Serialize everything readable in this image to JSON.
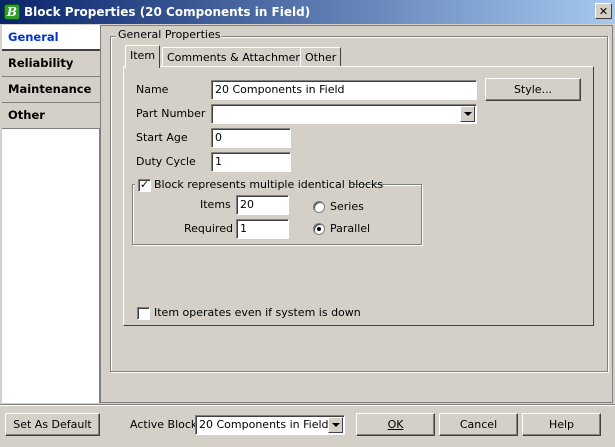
{
  "window": {
    "title": "Block Properties (20 Components in Field)",
    "close_glyph": "✕",
    "app_icon_letter": "B"
  },
  "nav": {
    "items": [
      {
        "label": "General",
        "selected": true
      },
      {
        "label": "Reliability",
        "selected": false
      },
      {
        "label": "Maintenance",
        "selected": false
      },
      {
        "label": "Other",
        "selected": false
      }
    ]
  },
  "general": {
    "group_title": "General Properties",
    "tabs": [
      {
        "label": "Item",
        "selected": true
      },
      {
        "label": "Comments & Attachments",
        "selected": false
      },
      {
        "label": "Other",
        "selected": false
      }
    ],
    "fields": {
      "name_label": "Name",
      "name_value": "20 Components in Field",
      "style_button": "Style...",
      "part_number_label": "Part Number",
      "part_number_value": "",
      "start_age_label": "Start Age",
      "start_age_value": "0",
      "duty_cycle_label": "Duty Cycle",
      "duty_cycle_value": "1"
    },
    "multiple": {
      "checkbox_label": "Block represents multiple identical blocks",
      "checked": true,
      "check_glyph": "✓",
      "items_label": "Items",
      "items_value": "20",
      "required_label": "Required",
      "required_value": "1",
      "series_label": "Series",
      "parallel_label": "Parallel",
      "selected_mode": "Parallel"
    },
    "operates_label": "Item operates even if system is down",
    "operates_checked": false
  },
  "footer": {
    "set_default_label": "Set As Default",
    "active_block_label": "Active Block:",
    "active_block_value": "20 Components in Field",
    "ok_label": "OK",
    "cancel_label": "Cancel",
    "help_label": "Help"
  }
}
